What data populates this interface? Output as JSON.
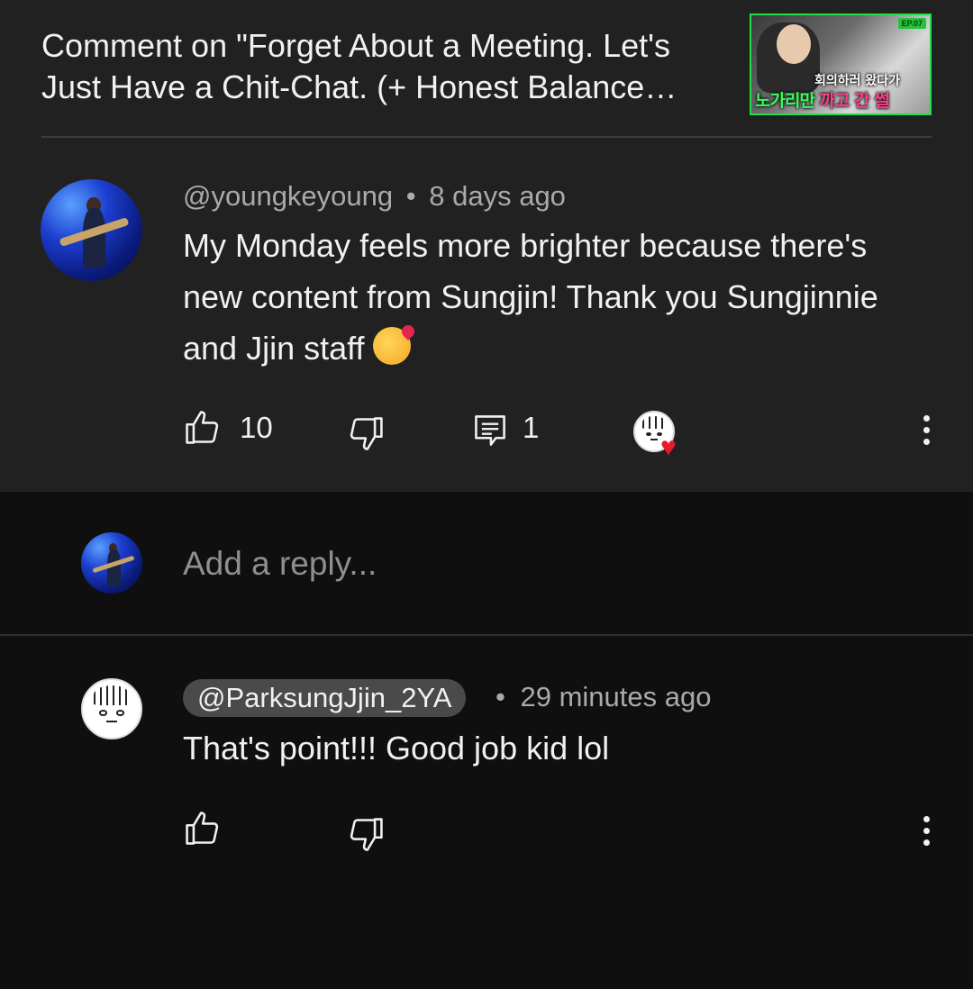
{
  "header": {
    "title": "Comment on \"Forget About a Meeting. Let's Just Have a Chit-Chat. (+ Honest Balance Game)\"",
    "thumbnail": {
      "badge": "EP.07",
      "caption_top": "회의하러 왔다가",
      "caption_main_green": "노가리만",
      "caption_main_pink": "까고 간 썰"
    }
  },
  "comment": {
    "author": "@youngkeyoung",
    "separator": "•",
    "time": "8 days ago",
    "text": "My Monday feels more brighter because there's new content from Sungjin! Thank you Sungjinnie and Jjin staff",
    "emoji": "smiling-face-with-hearts",
    "likes": "10",
    "replies": "1",
    "creator_heart": true
  },
  "reply_box": {
    "placeholder": "Add a reply..."
  },
  "reply": {
    "author": "@ParksungJjin_2YA",
    "separator": "•",
    "time": "29 minutes ago",
    "text": "That's point!!! Good job kid lol"
  },
  "colors": {
    "top_card_bg": "#212121",
    "page_bg": "#0f0f0f",
    "heart": "#e8192c",
    "thumbnail_border": "#1ee04a"
  }
}
